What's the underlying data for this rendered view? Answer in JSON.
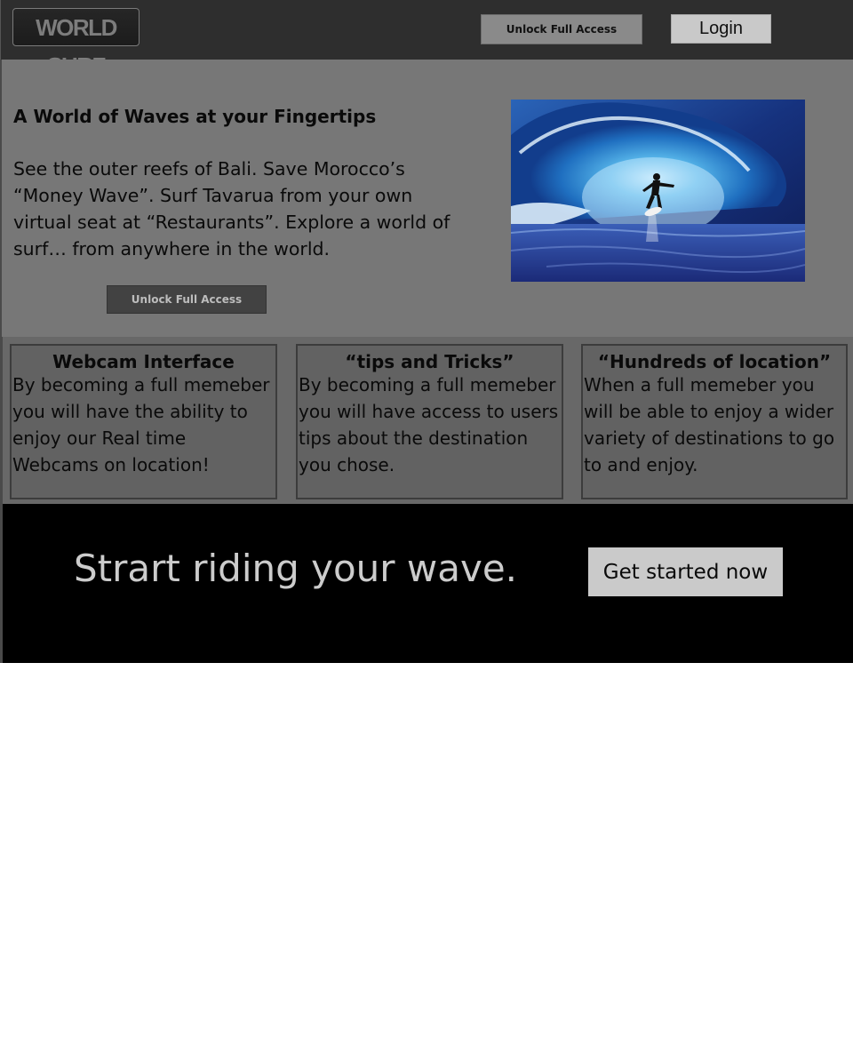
{
  "header": {
    "logo_text": "WORLD SURF",
    "unlock_label": "Unlock Full Access",
    "login_label": "Login"
  },
  "hero": {
    "title": "A World of Waves at your Fingertips",
    "body": "See the outer reefs of Bali. Save Morocco’s “Money Wave”. Surf Tavarua from your own virtual seat at “Restaurants”. Explore a world of surf… from anywhere in the world.",
    "unlock_label": "Unlock Full Access"
  },
  "features": [
    {
      "title": "Webcam Interface",
      "text": "By becoming a full memeber you will have the ability to enjoy our Real time Webcams on location!"
    },
    {
      "title": "“tips and Tricks”",
      "text": "By becoming a full memeber you will have access to users tips about the destination you chose."
    },
    {
      "title": "“Hundreds of location”",
      "text": "When a full memeber you will be able to enjoy a wider variety of destinations to go to and enjoy."
    }
  ],
  "cta": {
    "text": "Strart riding your wave.",
    "button_label": "Get started now"
  },
  "colors": {
    "header_bg": "#2e2e2e",
    "hero_bg": "#777777",
    "features_bg": "#686868",
    "cta_bg": "#000000"
  }
}
